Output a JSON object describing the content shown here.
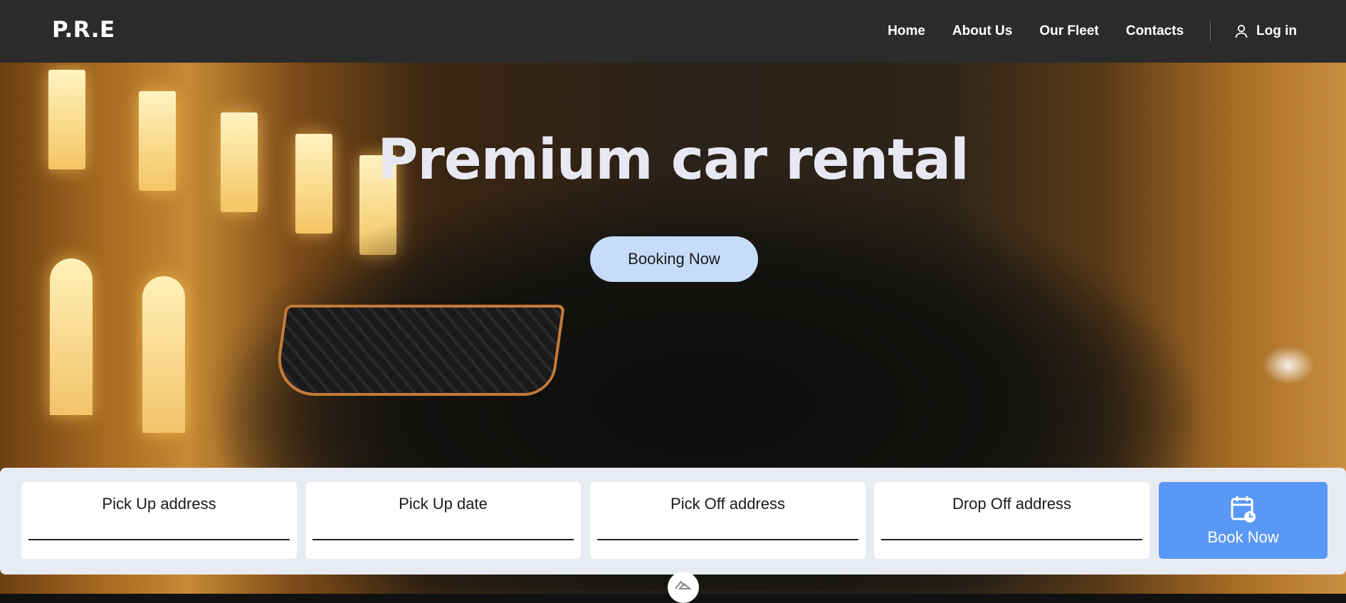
{
  "header": {
    "logo": "P.R.E",
    "nav": [
      {
        "label": "Home"
      },
      {
        "label": "About Us"
      },
      {
        "label": "Our Fleet"
      },
      {
        "label": "Contacts"
      }
    ],
    "login_label": "Log in",
    "login_icon": "user-icon"
  },
  "hero": {
    "title": "Premium car rental",
    "cta_label": "Booking Now"
  },
  "booking": {
    "fields": [
      {
        "label": "Pick Up address"
      },
      {
        "label": "Pick Up date"
      },
      {
        "label": "Pick Off address"
      },
      {
        "label": "Drop Off address"
      }
    ],
    "button_label": "Book Now",
    "button_icon": "calendar-clock-icon"
  },
  "scroll_top_icon": "chevron-up-icon",
  "colors": {
    "header_bg": "#2b2b2b",
    "cta_bg": "#c7dcfb",
    "book_button_bg": "#5a98f6",
    "booking_bar_bg": "#e9ebf3"
  }
}
